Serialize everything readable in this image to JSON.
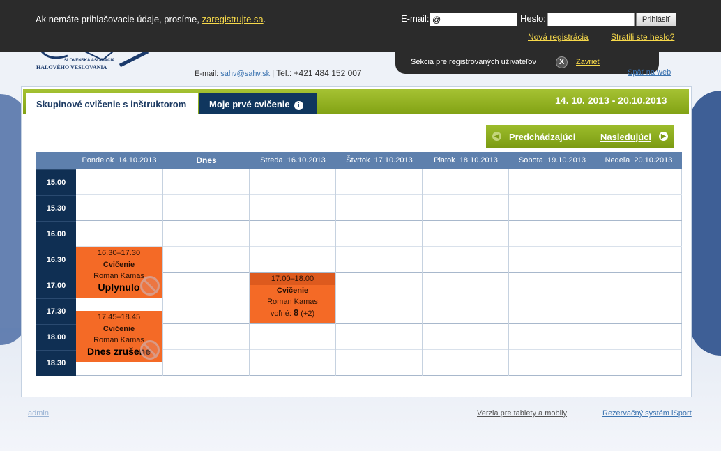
{
  "topbar": {
    "notice_text": "Ak nemáte prihlašovacie údaje, prosíme,",
    "notice_link": "zaregistrujte sa",
    "notice_end": ".",
    "email_label": "E-mail:",
    "email_value": "@",
    "password_label": "Heslo:",
    "password_value": "",
    "login_button": "Prihlásiť",
    "new_registration": "Nová registrácia",
    "lost_password": "Stratili ste heslo?"
  },
  "panel": {
    "text": "Sekcia pre registrovaných užívateľov",
    "close_symbol": "X",
    "close_label": "Zavrieť"
  },
  "header": {
    "logo_line1": "SLOVENSKÁ ASOCIÁCIA",
    "logo_line2": "HALOVÉHO VESLOVANIA",
    "email_label": "E-mail:",
    "email": "sahv@sahv.sk",
    "separator": "|",
    "tel": "Tel.: +421 484 152 007",
    "web_link": "Späť na web"
  },
  "tabs": [
    {
      "label": "Skupinové cvičenie s inštruktorom",
      "active": true
    },
    {
      "label": "Moje prvé cvičenie",
      "active": false,
      "icon": "info-icon"
    }
  ],
  "date_range": "14. 10. 2013 - 20.10.2013",
  "navigation": {
    "prev_label": "Predchádzajúci",
    "next_label": "Nasledujúci"
  },
  "calendar": {
    "days": [
      {
        "name": "Pondelok",
        "date": "14.10.2013"
      },
      {
        "name": "Dnes",
        "date": ""
      },
      {
        "name": "Streda",
        "date": "16.10.2013"
      },
      {
        "name": "Štvrtok",
        "date": "17.10.2013"
      },
      {
        "name": "Piatok",
        "date": "18.10.2013"
      },
      {
        "name": "Sobota",
        "date": "19.10.2013"
      },
      {
        "name": "Nedeľa",
        "date": "20.10.2013"
      }
    ],
    "times": [
      "15.00",
      "15.30",
      "16.00",
      "16.30",
      "17.00",
      "17.30",
      "18.00",
      "18.30"
    ],
    "events": [
      {
        "time": "16.30–17.30",
        "title": "Cvičenie",
        "person": "Roman Kamas",
        "status": "Uplynulo"
      },
      {
        "time": "17.45–18.45",
        "title": "Cvičenie",
        "person": "Roman Kamas",
        "status": "Dnes zrušené"
      },
      {
        "time": "17.00–18.00",
        "title": "Cvičenie",
        "person": "Roman Kamas",
        "free_label": "voľné:",
        "free_count": "8",
        "free_extra": "(+2)"
      }
    ]
  },
  "footer": {
    "admin": "admin",
    "mobile": "Verzia pre tablety a mobily",
    "isport": "Rezervačný systém iSport"
  },
  "colors": {
    "topbar": "#2b2b2b",
    "link_yellow": "#f7d94a",
    "green": "#8fae1e",
    "navy": "#10365e",
    "event_orange": "#f46a26",
    "header_blue": "#5e80ad"
  }
}
